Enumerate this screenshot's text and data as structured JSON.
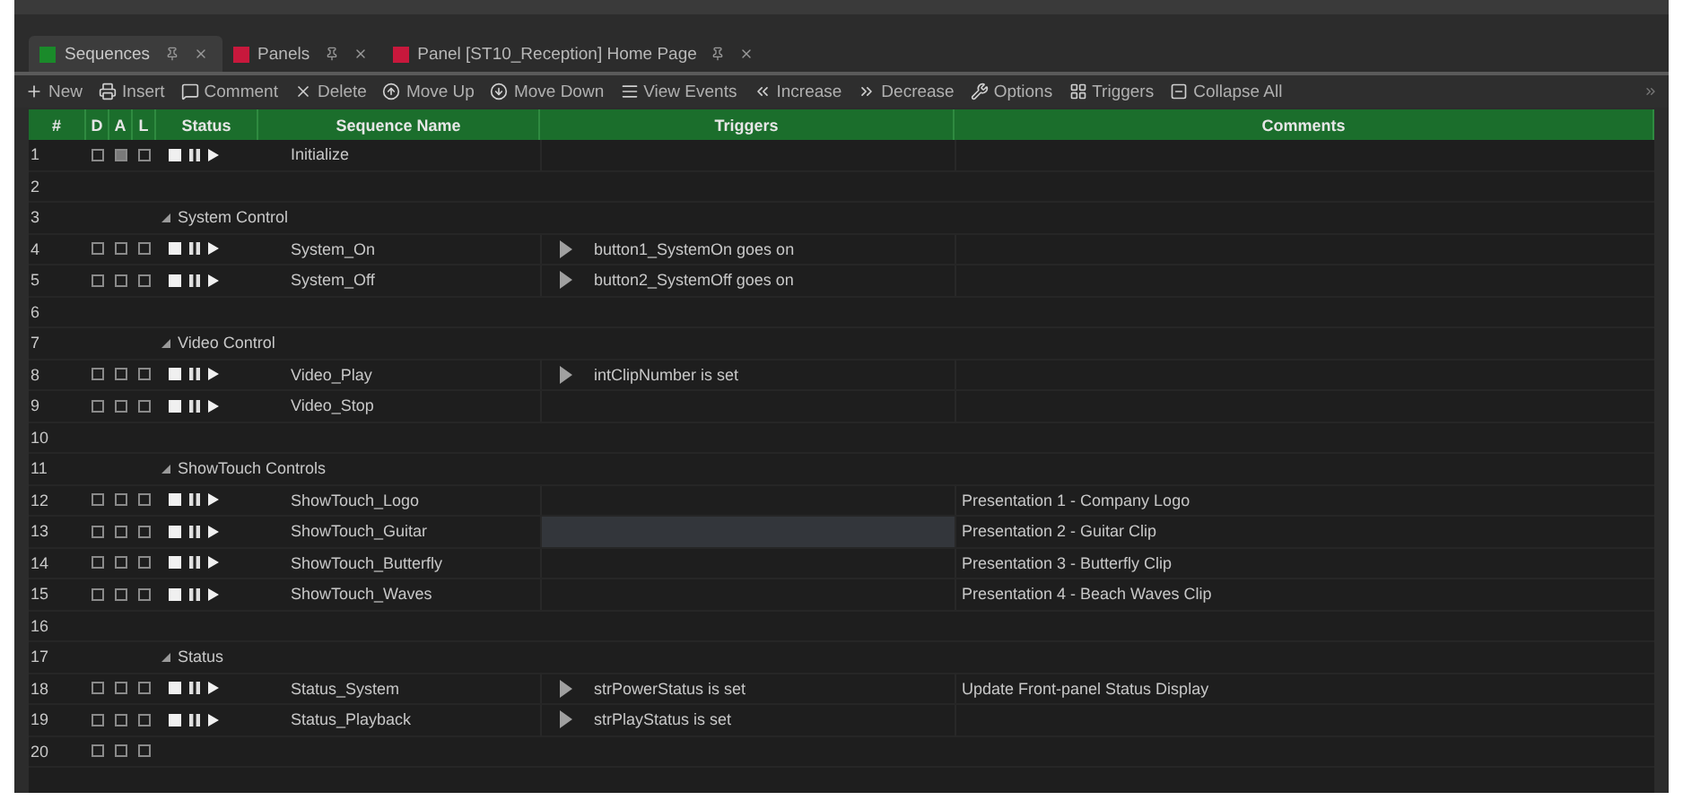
{
  "tabs": [
    {
      "label": "Sequences",
      "color": "#1a8a2a",
      "selected": true
    },
    {
      "label": "Panels",
      "color": "#c8183c",
      "selected": false
    },
    {
      "label": "Panel [ST10_Reception] Home Page",
      "color": "#c8183c",
      "selected": false
    }
  ],
  "toolbar": [
    "New",
    "Insert",
    "Comment",
    "Delete",
    "Move Up",
    "Move Down",
    "View Events",
    "Increase",
    "Decrease",
    "Options",
    "Triggers",
    "Collapse All"
  ],
  "table": {
    "columns": [
      "#",
      "D",
      "A",
      "L",
      "Status",
      "Sequence Name",
      "Triggers",
      "Comments"
    ],
    "rows": [
      {
        "number": "1",
        "kind": "sequence",
        "d": false,
        "a": true,
        "l": false,
        "name": "Initialize",
        "trigger_focused": false
      },
      {
        "number": "2",
        "kind": "empty"
      },
      {
        "number": "3",
        "kind": "group",
        "name": "System Control",
        "expanded": true
      },
      {
        "number": "4",
        "kind": "sequence",
        "d": false,
        "a": false,
        "l": false,
        "name": "System_On",
        "trigger": "button1_SystemOn goes on",
        "trigger_focused": false
      },
      {
        "number": "5",
        "kind": "sequence",
        "d": false,
        "a": false,
        "l": false,
        "name": "System_Off",
        "trigger": "button2_SystemOff goes on",
        "trigger_focused": false
      },
      {
        "number": "6",
        "kind": "empty"
      },
      {
        "number": "7",
        "kind": "group",
        "name": "Video Control",
        "expanded": true
      },
      {
        "number": "8",
        "kind": "sequence",
        "d": false,
        "a": false,
        "l": false,
        "name": "Video_Play",
        "trigger": "intClipNumber is set",
        "trigger_focused": false
      },
      {
        "number": "9",
        "kind": "sequence",
        "d": false,
        "a": false,
        "l": false,
        "name": "Video_Stop",
        "trigger_focused": false
      },
      {
        "number": "10",
        "kind": "empty"
      },
      {
        "number": "11",
        "kind": "group",
        "name": "ShowTouch Controls",
        "expanded": true
      },
      {
        "number": "12",
        "kind": "sequence",
        "d": false,
        "a": false,
        "l": false,
        "name": "ShowTouch_Logo",
        "comment": "Presentation 1 - Company Logo",
        "trigger_focused": false
      },
      {
        "number": "13",
        "kind": "sequence",
        "d": false,
        "a": false,
        "l": false,
        "name": "ShowTouch_Guitar",
        "comment": "Presentation 2 - Guitar Clip",
        "trigger_focused": true
      },
      {
        "number": "14",
        "kind": "sequence",
        "d": false,
        "a": false,
        "l": false,
        "name": "ShowTouch_Butterfly",
        "comment": "Presentation 3 - Butterfly Clip",
        "trigger_focused": false
      },
      {
        "number": "15",
        "kind": "sequence",
        "d": false,
        "a": false,
        "l": false,
        "name": "ShowTouch_Waves",
        "comment": "Presentation 4 - Beach Waves Clip",
        "trigger_focused": false
      },
      {
        "number": "16",
        "kind": "empty"
      },
      {
        "number": "17",
        "kind": "group",
        "name": "Status",
        "expanded": true
      },
      {
        "number": "18",
        "kind": "sequence",
        "d": false,
        "a": false,
        "l": false,
        "name": "Status_System",
        "trigger": "strPowerStatus is set",
        "comment": "Update Front-panel Status Display",
        "trigger_focused": false
      },
      {
        "number": "19",
        "kind": "sequence",
        "d": false,
        "a": false,
        "l": false,
        "name": "Status_Playback",
        "trigger": "strPlayStatus is set",
        "trigger_focused": false
      },
      {
        "number": "20",
        "kind": "new",
        "d": false,
        "a": false,
        "l": false
      }
    ]
  }
}
